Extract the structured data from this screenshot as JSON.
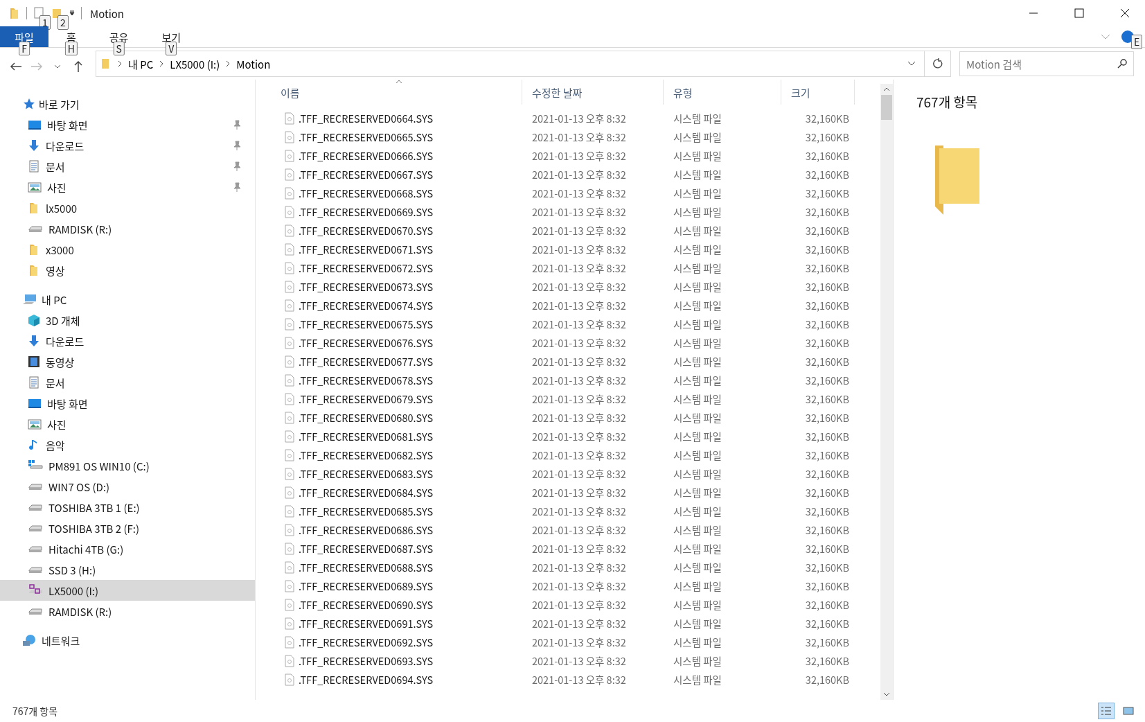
{
  "window": {
    "title": "Motion",
    "quick_access_keytips": [
      "1",
      "2"
    ]
  },
  "ribbon": {
    "tabs": [
      {
        "label": "파일",
        "keytip": "F",
        "selected": true
      },
      {
        "label": "홈",
        "keytip": "H",
        "selected": false
      },
      {
        "label": "공유",
        "keytip": "S",
        "selected": false
      },
      {
        "label": "보기",
        "keytip": "V",
        "selected": false
      }
    ],
    "help_keytip": "E"
  },
  "address": {
    "crumbs": [
      "내 PC",
      "LX5000 (I:)",
      "Motion"
    ],
    "search_placeholder": "Motion 검색"
  },
  "sidebar": {
    "groups": [
      {
        "label": "바로 가기",
        "children": [
          {
            "label": "바탕 화면",
            "pinned": true,
            "selected": false
          },
          {
            "label": "다운로드",
            "pinned": true,
            "selected": false
          },
          {
            "label": "문서",
            "pinned": true,
            "selected": false
          },
          {
            "label": "사진",
            "pinned": true,
            "selected": false
          },
          {
            "label": "lx5000",
            "pinned": false,
            "selected": false
          },
          {
            "label": "RAMDISK (R:)",
            "pinned": false,
            "selected": false
          },
          {
            "label": "x3000",
            "pinned": false,
            "selected": false
          },
          {
            "label": "영상",
            "pinned": false,
            "selected": false
          }
        ]
      },
      {
        "label": "내 PC",
        "children": [
          {
            "label": "3D 개체",
            "pinned": false,
            "selected": false
          },
          {
            "label": "다운로드",
            "pinned": false,
            "selected": false
          },
          {
            "label": "동영상",
            "pinned": false,
            "selected": false
          },
          {
            "label": "문서",
            "pinned": false,
            "selected": false
          },
          {
            "label": "바탕 화면",
            "pinned": false,
            "selected": false
          },
          {
            "label": "사진",
            "pinned": false,
            "selected": false
          },
          {
            "label": "음악",
            "pinned": false,
            "selected": false
          },
          {
            "label": "PM891 OS WIN10 (C:)",
            "pinned": false,
            "selected": false
          },
          {
            "label": "WIN7 OS (D:)",
            "pinned": false,
            "selected": false
          },
          {
            "label": "TOSHIBA 3TB 1 (E:)",
            "pinned": false,
            "selected": false
          },
          {
            "label": "TOSHIBA 3TB 2 (F:)",
            "pinned": false,
            "selected": false
          },
          {
            "label": "Hitachi 4TB (G:)",
            "pinned": false,
            "selected": false
          },
          {
            "label": "SSD 3 (H:)",
            "pinned": false,
            "selected": false
          },
          {
            "label": "LX5000 (I:)",
            "pinned": false,
            "selected": true
          },
          {
            "label": "RAMDISK (R:)",
            "pinned": false,
            "selected": false
          }
        ]
      },
      {
        "label": "네트워크"
      }
    ]
  },
  "table": {
    "columns": [
      "이름",
      "수정한 날짜",
      "유형",
      "크기"
    ],
    "rows": [
      {
        "name": ".TFF_RECRESERVED0664.SYS",
        "date": "2021-01-13 오후 8:32",
        "type": "시스템 파일",
        "size": "32,160KB"
      },
      {
        "name": ".TFF_RECRESERVED0665.SYS",
        "date": "2021-01-13 오후 8:32",
        "type": "시스템 파일",
        "size": "32,160KB"
      },
      {
        "name": ".TFF_RECRESERVED0666.SYS",
        "date": "2021-01-13 오후 8:32",
        "type": "시스템 파일",
        "size": "32,160KB"
      },
      {
        "name": ".TFF_RECRESERVED0667.SYS",
        "date": "2021-01-13 오후 8:32",
        "type": "시스템 파일",
        "size": "32,160KB"
      },
      {
        "name": ".TFF_RECRESERVED0668.SYS",
        "date": "2021-01-13 오후 8:32",
        "type": "시스템 파일",
        "size": "32,160KB"
      },
      {
        "name": ".TFF_RECRESERVED0669.SYS",
        "date": "2021-01-13 오후 8:32",
        "type": "시스템 파일",
        "size": "32,160KB"
      },
      {
        "name": ".TFF_RECRESERVED0670.SYS",
        "date": "2021-01-13 오후 8:32",
        "type": "시스템 파일",
        "size": "32,160KB"
      },
      {
        "name": ".TFF_RECRESERVED0671.SYS",
        "date": "2021-01-13 오후 8:32",
        "type": "시스템 파일",
        "size": "32,160KB"
      },
      {
        "name": ".TFF_RECRESERVED0672.SYS",
        "date": "2021-01-13 오후 8:32",
        "type": "시스템 파일",
        "size": "32,160KB"
      },
      {
        "name": ".TFF_RECRESERVED0673.SYS",
        "date": "2021-01-13 오후 8:32",
        "type": "시스템 파일",
        "size": "32,160KB"
      },
      {
        "name": ".TFF_RECRESERVED0674.SYS",
        "date": "2021-01-13 오후 8:32",
        "type": "시스템 파일",
        "size": "32,160KB"
      },
      {
        "name": ".TFF_RECRESERVED0675.SYS",
        "date": "2021-01-13 오후 8:32",
        "type": "시스템 파일",
        "size": "32,160KB"
      },
      {
        "name": ".TFF_RECRESERVED0676.SYS",
        "date": "2021-01-13 오후 8:32",
        "type": "시스템 파일",
        "size": "32,160KB"
      },
      {
        "name": ".TFF_RECRESERVED0677.SYS",
        "date": "2021-01-13 오후 8:32",
        "type": "시스템 파일",
        "size": "32,160KB"
      },
      {
        "name": ".TFF_RECRESERVED0678.SYS",
        "date": "2021-01-13 오후 8:32",
        "type": "시스템 파일",
        "size": "32,160KB"
      },
      {
        "name": ".TFF_RECRESERVED0679.SYS",
        "date": "2021-01-13 오후 8:32",
        "type": "시스템 파일",
        "size": "32,160KB"
      },
      {
        "name": ".TFF_RECRESERVED0680.SYS",
        "date": "2021-01-13 오후 8:32",
        "type": "시스템 파일",
        "size": "32,160KB"
      },
      {
        "name": ".TFF_RECRESERVED0681.SYS",
        "date": "2021-01-13 오후 8:32",
        "type": "시스템 파일",
        "size": "32,160KB"
      },
      {
        "name": ".TFF_RECRESERVED0682.SYS",
        "date": "2021-01-13 오후 8:32",
        "type": "시스템 파일",
        "size": "32,160KB"
      },
      {
        "name": ".TFF_RECRESERVED0683.SYS",
        "date": "2021-01-13 오후 8:32",
        "type": "시스템 파일",
        "size": "32,160KB"
      },
      {
        "name": ".TFF_RECRESERVED0684.SYS",
        "date": "2021-01-13 오후 8:32",
        "type": "시스템 파일",
        "size": "32,160KB"
      },
      {
        "name": ".TFF_RECRESERVED0685.SYS",
        "date": "2021-01-13 오후 8:32",
        "type": "시스템 파일",
        "size": "32,160KB"
      },
      {
        "name": ".TFF_RECRESERVED0686.SYS",
        "date": "2021-01-13 오후 8:32",
        "type": "시스템 파일",
        "size": "32,160KB"
      },
      {
        "name": ".TFF_RECRESERVED0687.SYS",
        "date": "2021-01-13 오후 8:32",
        "type": "시스템 파일",
        "size": "32,160KB"
      },
      {
        "name": ".TFF_RECRESERVED0688.SYS",
        "date": "2021-01-13 오후 8:32",
        "type": "시스템 파일",
        "size": "32,160KB"
      },
      {
        "name": ".TFF_RECRESERVED0689.SYS",
        "date": "2021-01-13 오후 8:32",
        "type": "시스템 파일",
        "size": "32,160KB"
      },
      {
        "name": ".TFF_RECRESERVED0690.SYS",
        "date": "2021-01-13 오후 8:32",
        "type": "시스템 파일",
        "size": "32,160KB"
      },
      {
        "name": ".TFF_RECRESERVED0691.SYS",
        "date": "2021-01-13 오후 8:32",
        "type": "시스템 파일",
        "size": "32,160KB"
      },
      {
        "name": ".TFF_RECRESERVED0692.SYS",
        "date": "2021-01-13 오후 8:32",
        "type": "시스템 파일",
        "size": "32,160KB"
      },
      {
        "name": ".TFF_RECRESERVED0693.SYS",
        "date": "2021-01-13 오후 8:32",
        "type": "시스템 파일",
        "size": "32,160KB"
      },
      {
        "name": ".TFF_RECRESERVED0694.SYS",
        "date": "2021-01-13 오후 8:32",
        "type": "시스템 파일",
        "size": "32,160KB"
      }
    ]
  },
  "preview": {
    "count": "767개 항목"
  },
  "status_bar": {
    "count": "767개 항목"
  }
}
